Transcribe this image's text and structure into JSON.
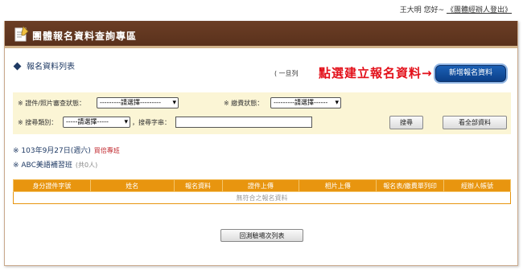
{
  "topbar": {
    "greeting": "王大明 您好~",
    "logout_label": "《團體經辦人登出》"
  },
  "header": {
    "title": "團體報名資料查詢專區",
    "icon": "edit-icon"
  },
  "section": {
    "title": "報名資料列表"
  },
  "hint": {
    "small_text": "( 一旦列",
    "callout": "點選建立報名資料→"
  },
  "new_button_label": "新增報名資料",
  "filters": {
    "cert_label": "※ 證件/照片審查狀態：",
    "cert_value": "---------請選擇---------",
    "fee_label": "※ 繳費狀態：",
    "fee_value": "---------請選擇------",
    "search_type_label": "※ 搜尋類別：",
    "search_type_value": "-----請選擇-----",
    "keyword_label": "，搜尋字串：",
    "keyword_value": "",
    "search_button": "搜尋",
    "show_all_button": "看全部資料"
  },
  "session": {
    "date": "※ 103年9月27日(週六)",
    "tag": "買倍專班",
    "class_name": "※ ABC美語補習班",
    "class_count": "(共0人)"
  },
  "table": {
    "columns": [
      "身分證件字號",
      "姓名",
      "報名資料",
      "證件上傳",
      "相片上傳",
      "報名表/繳費單列印",
      "經辦人帳號"
    ],
    "empty_message": "無符合之報名資料"
  },
  "back_button_label": "回測驗場次列表",
  "colors": {
    "header_bg": "#5a311c",
    "table_header": "#e8950f",
    "filter_bg": "#fbf5d5",
    "callout": "#e3101a",
    "primary_button": "#0b3f88"
  }
}
